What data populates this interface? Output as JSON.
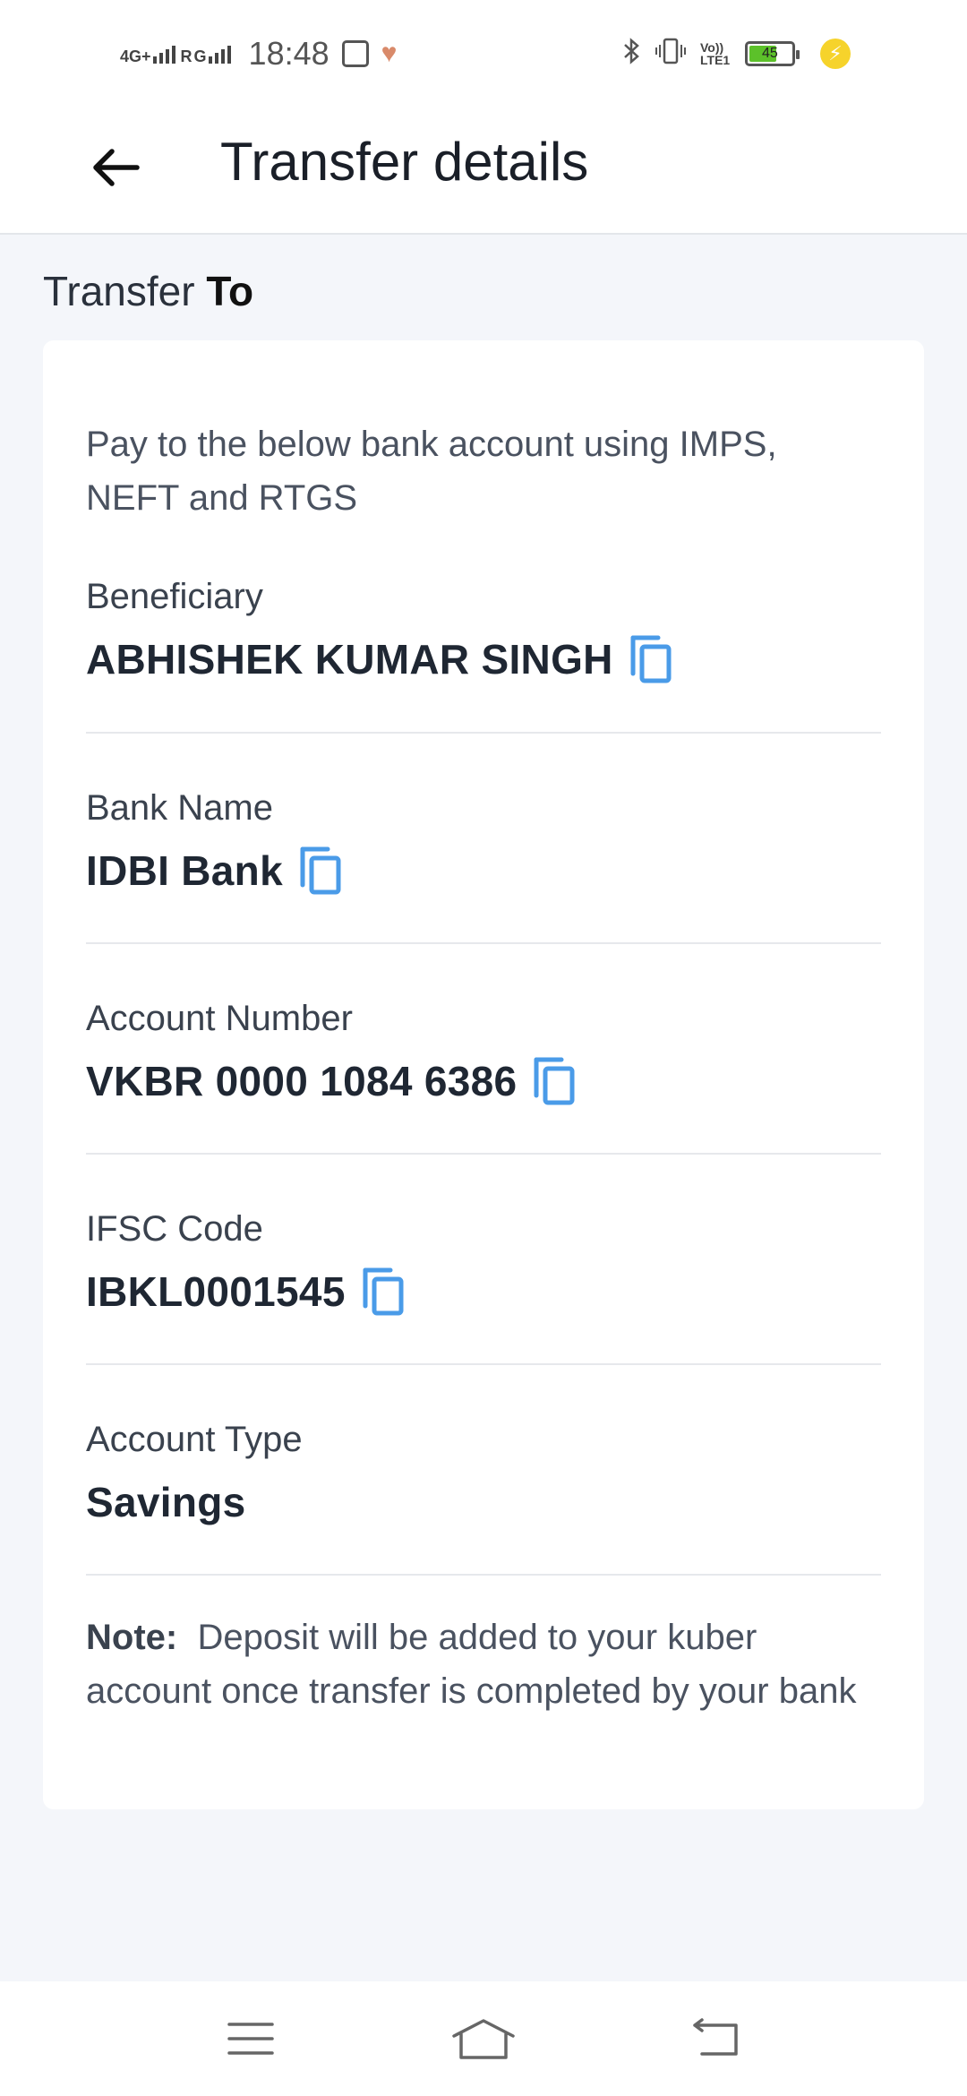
{
  "status_bar": {
    "network_1": "4G+",
    "network_2": "R",
    "network_3": "G",
    "time": "18:48",
    "volte": "Vo)) LTE1",
    "battery_level": "45",
    "battery_color": "#5cc12a",
    "icons": [
      "signal-icon",
      "mail-icon",
      "health-icon",
      "bluetooth-icon",
      "vibrate-icon",
      "battery-icon",
      "charging-icon"
    ]
  },
  "app_bar": {
    "back_icon": "arrow-left-icon",
    "title": "Transfer details"
  },
  "section": {
    "heading_prefix": "Transfer",
    "heading_bold": "To"
  },
  "card": {
    "intro": "Pay to the below bank account using IMPS, NEFT and RTGS",
    "fields": [
      {
        "label": "Beneficiary",
        "value": "ABHISHEK KUMAR SINGH",
        "copyable": true
      },
      {
        "label": "Bank Name",
        "value": "IDBI Bank",
        "copyable": true
      },
      {
        "label": "Account Number",
        "value": "VKBR 0000 1084 6386",
        "copyable": true
      },
      {
        "label": "IFSC Code",
        "value": "IBKL0001545",
        "copyable": true
      },
      {
        "label": "Account Type",
        "value": "Savings",
        "copyable": false
      }
    ],
    "note_label": "Note:",
    "note_text": "Deposit will be added to your kuber account once transfer is completed by your bank"
  },
  "colors": {
    "accent": "#4a9be8",
    "background": "#f4f6fa",
    "card": "#ffffff"
  },
  "nav_bar": {
    "icons": [
      "menu-icon",
      "home-icon",
      "back-nav-icon"
    ]
  }
}
